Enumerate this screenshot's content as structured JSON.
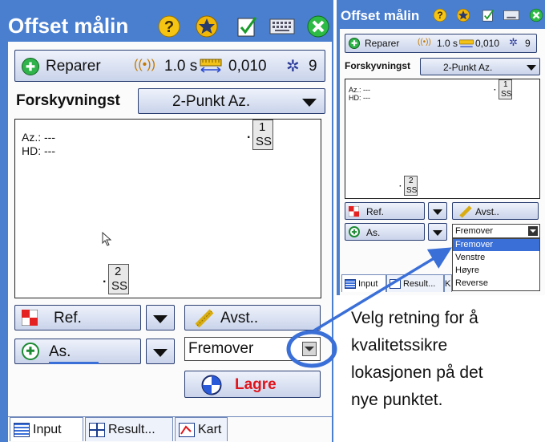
{
  "main_window": {
    "title": "Offset målin",
    "status": {
      "fix": "Reparer",
      "interval": "1.0 s",
      "precision": "0,010",
      "satellites": "9"
    },
    "method_label": "Forskyvningst",
    "method_value": "2-Punkt Az.",
    "readout": {
      "az": "Az.: ---",
      "hd": "HD: ---"
    },
    "points": [
      {
        "num": "1",
        "code": "SS"
      },
      {
        "num": "2",
        "code": "SS"
      }
    ],
    "ref_label": "Ref.",
    "avst_label": "Avst..",
    "as_label": "As.",
    "direction_value": "Fremover",
    "save_label": "Lagre",
    "tabs": [
      "Input",
      "Result...",
      "Kart"
    ]
  },
  "inset_window": {
    "title": "Offset målin",
    "status": {
      "fix": "Reparer",
      "interval": "1.0 s",
      "precision": "0,010",
      "satellites": "9"
    },
    "method_label": "Forskyvningst",
    "method_value": "2-Punkt Az.",
    "readout": {
      "az": "Az.: ---",
      "hd": "HD: ---"
    },
    "points": [
      {
        "num": "1",
        "code": "SS"
      },
      {
        "num": "2",
        "code": "SS"
      }
    ],
    "ref_label": "Ref.",
    "avst_label": "Avst..",
    "as_label": "As.",
    "direction_value": "Fremover",
    "direction_options": [
      "Fremover",
      "Venstre",
      "Høyre",
      "Reverse"
    ],
    "tabs": [
      "Input",
      "Result...",
      "K"
    ]
  },
  "callout": {
    "lines": [
      "Velg retning for å",
      "kvalitetssikre",
      "lokasjonen på det",
      "nye punktet."
    ]
  },
  "colors": {
    "title_bar": "#4a7fd0",
    "highlight": "#3a6fd8",
    "save_text": "#e0141a",
    "callout_line": "#3a6fd8"
  }
}
